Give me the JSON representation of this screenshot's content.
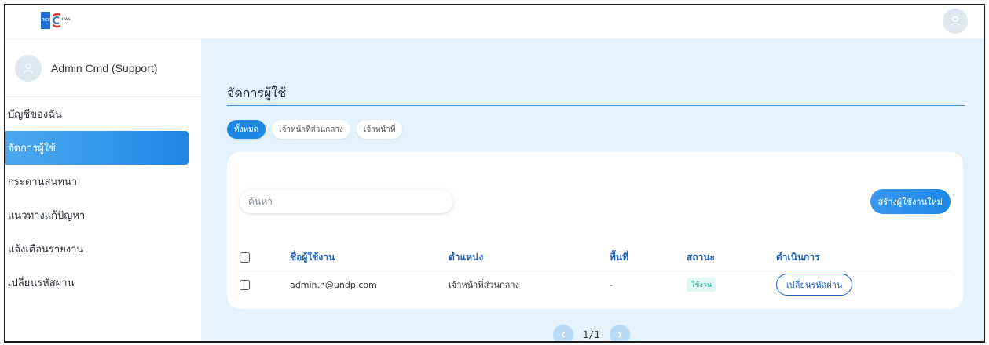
{
  "header": {
    "logo_text": "UNDP"
  },
  "sidebar": {
    "profile_name": "Admin Cmd (Support)",
    "items": [
      {
        "label": "บัญชีของฉัน"
      },
      {
        "label": "จัดการผู้ใช้"
      },
      {
        "label": "กระดานสนทนา"
      },
      {
        "label": "แนวทางแก้ปัญหา"
      },
      {
        "label": "แจ้งเตือนรายงาน"
      },
      {
        "label": "เปลี่ยนรหัสผ่าน"
      }
    ],
    "active_index": 1
  },
  "main": {
    "title": "จัดการผู้ใช้",
    "tabs": [
      {
        "label": "ทั้งหมด"
      },
      {
        "label": "เจ้าหน้าที่ส่วนกลาง"
      },
      {
        "label": "เจ้าหน้าที่"
      }
    ],
    "active_tab": 0,
    "search": {
      "placeholder": "ค้นหา"
    },
    "create_button": "สร้างผู้ใช้งานใหม่",
    "table": {
      "columns": [
        "ชื่อผู้ใช้งาน",
        "ตำแหน่ง",
        "พื้นที่",
        "สถานะ",
        "ดำเนินการ"
      ],
      "rows": [
        {
          "username": "admin.n@undp.com",
          "position": "เจ้าหน้าที่ส่วนกลาง",
          "area": "-",
          "status": "ใช้งาน",
          "action": "เปลี่ยนรหัสผ่าน"
        }
      ]
    },
    "pagination": {
      "label": "1/1"
    }
  },
  "colors": {
    "accent": "#1e88e5",
    "main_bg": "#e3f2fc",
    "status_text": "#1bb39a",
    "header_text": "#2563b8"
  }
}
